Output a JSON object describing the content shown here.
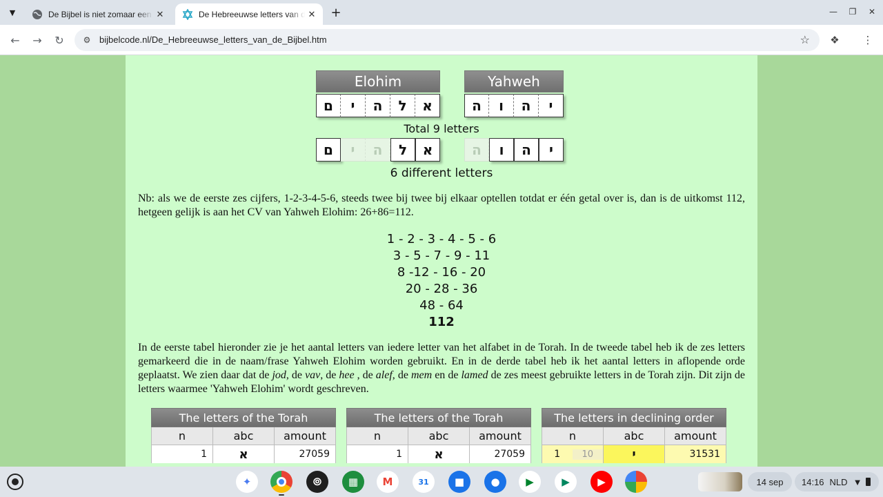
{
  "browser": {
    "tabs": [
      {
        "title": "De Bijbel is niet zomaar een boek",
        "favicon": "globe-icon",
        "active": false
      },
      {
        "title": "De Hebreeuwse letters van de Bijbel",
        "favicon": "star-of-david-icon",
        "active": true
      }
    ],
    "url": "bijbelcode.nl/De_Hebreeuwse_letters_van_de_Bijbel.htm"
  },
  "page": {
    "elohim_label": "Elohim",
    "yahweh_label": "Yahweh",
    "elohim_letters": [
      "ם",
      "י",
      "ה",
      "ל",
      "א"
    ],
    "yahweh_letters": [
      "ה",
      "ו",
      "ה",
      "י"
    ],
    "total_caption": "Total 9 letters",
    "different_caption": "6 different letters",
    "nb_paragraph": "Nb: als we de eerste zes cijfers, 1-2-3-4-5-6, steeds twee bij twee bij elkaar optellen totdat er  één getal over is, dan is de uitkomst 112, hetgeen gelijk is aan het CV van Yahweh Elohim: 26+86=112.",
    "sums": [
      "1 - 2 - 3 - 4 - 5 - 6",
      "3 - 5 - 7 - 9 - 11",
      "8 -12 - 16 - 20",
      "20 - 28 - 36",
      "48 - 64",
      "112"
    ],
    "explain": {
      "p1": "In de eerste tabel hieronder zie je het aantal letters van iedere letter van het alfabet in de Torah. In de tweede tabel heb ik de zes letters gemarkeerd die in de naam/frase Yahweh Elohim worden gebruikt. En in de derde tabel heb ik het aantal letters in aflopende orde geplaatst. We zien daar dat de ",
      "jod": "jod",
      "s1": ", de ",
      "vav": "vav",
      "s2": ", de ",
      "hee": "hee",
      "s3": " , de ",
      "alef": "alef",
      "s4": ", de ",
      "mem": "mem",
      "s5": " en de ",
      "lamed": "lamed",
      "p2": " de zes meest gebruikte letters in de Torah zijn. Dit zijn de letters waarmee 'Yahweh Elohim' wordt geschreven."
    },
    "tables": [
      {
        "title": "The letters of the Torah",
        "columns": [
          "n",
          "abc",
          "amount"
        ],
        "row": {
          "n": "1",
          "abc": "א",
          "amount": "27059"
        }
      },
      {
        "title": "The letters of the Torah",
        "columns": [
          "n",
          "abc",
          "amount"
        ],
        "row": {
          "n": "1",
          "abc": "א",
          "amount": "27059"
        }
      },
      {
        "title": "The letters in declining order",
        "columns": [
          "n",
          "abc",
          "amount"
        ],
        "row": {
          "n": "1",
          "n2": "10",
          "abc": "י",
          "amount": "31531"
        }
      }
    ]
  },
  "shelf": {
    "apps": [
      "gemini",
      "chrome",
      "podcasts",
      "app-grid",
      "gmail",
      "calendar",
      "files",
      "messages",
      "meet",
      "play-store",
      "youtube",
      "photos"
    ],
    "calendar_day": "31",
    "date": "14 sep",
    "time": "14:16",
    "ime": "NLD"
  },
  "colors": {
    "page_bg": "#a8d89a",
    "content_bg": "#cdfccb",
    "table_header": "#7d7d7d",
    "highlight_yellow": "#fbf65c"
  }
}
